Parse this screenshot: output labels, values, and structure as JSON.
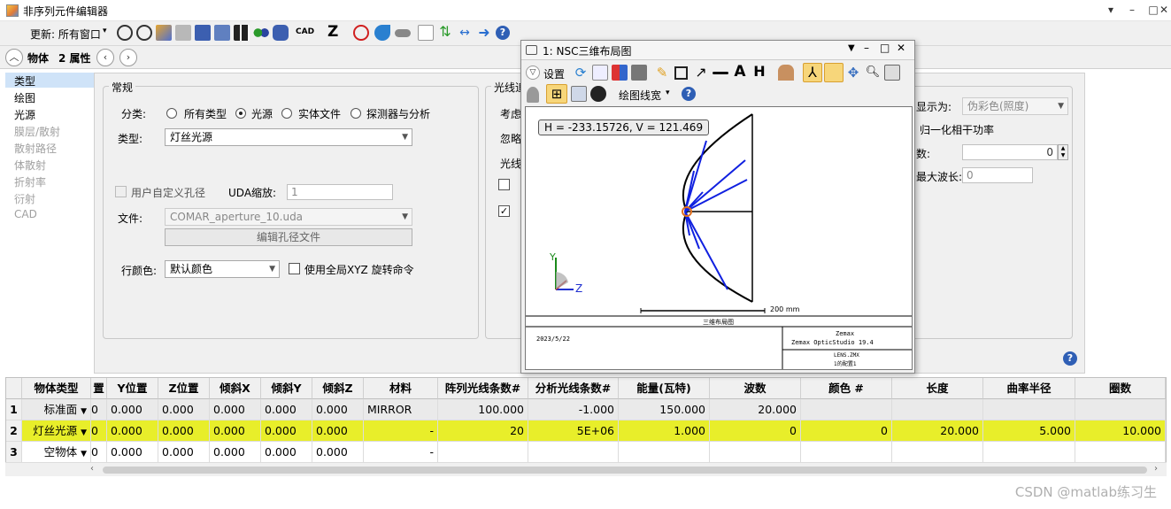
{
  "window": {
    "title": "非序列元件编辑器",
    "min": "–",
    "max": "□",
    "close": "✕",
    "pin": "▾"
  },
  "toolbar": {
    "update_label": "更新: 所有窗口",
    "cad_label": "CAD",
    "z_label": "Z"
  },
  "subbar": {
    "tab_object": "物体",
    "tab_props": "2 属性"
  },
  "nav": {
    "items": [
      {
        "label": "类型",
        "active": true,
        "enabled": true
      },
      {
        "label": "绘图",
        "enabled": true
      },
      {
        "label": "光源",
        "enabled": true
      },
      {
        "label": "膜层/散射",
        "enabled": false
      },
      {
        "label": "散射路径",
        "enabled": false
      },
      {
        "label": " 体散射",
        "enabled": false
      },
      {
        "label": "折射率",
        "enabled": false
      },
      {
        "label": "衍射",
        "enabled": false
      },
      {
        "label": " CAD",
        "enabled": false
      }
    ]
  },
  "general": {
    "group_title": "常规",
    "category_label": "分类:",
    "radios": [
      "所有类型",
      "光源",
      "实体文件",
      "探测器与分析"
    ],
    "type_label": "类型:",
    "type_value": "灯丝光源",
    "user_aperture_label": "用户自定义孔径",
    "uda_scale_label": "UDA缩放:",
    "uda_scale_value": "1",
    "file_label": "文件:",
    "file_value": "COMAR_aperture_10.uda",
    "edit_aperture_button": "编辑孔径文件",
    "row_color_label": "行颜色:",
    "row_color_value": "默认颜色",
    "global_xyz_label": "使用全局XYZ 旋转命令"
  },
  "raytrace": {
    "group_title": "光线追",
    "lines": [
      "考虑",
      "忽略",
      "光线"
    ]
  },
  "right_panel": {
    "display_label": "显示为:",
    "display_value": "伪彩色(照度)",
    "normalize_label": "归一化相干功率",
    "num_label": "数:",
    "num_value": "0",
    "max_wave_label": "最大波长:",
    "max_wave_value": "0"
  },
  "float_window": {
    "title": "1: NSC三维布局图",
    "settings_label": "设置",
    "linewidth_label": "绘图线宽",
    "coord_readout": "H = -233.15726, V = 121.469",
    "axis_y": "Y",
    "axis_z": "Z",
    "scale_label": "200 mm",
    "footer_title": "三维布局图",
    "footer_date": "2023/5/22",
    "footer_brand": "Zemax",
    "footer_product": "Zemax OpticStudio 19.4",
    "footer_file": "LENS.ZMX",
    "footer_config": "1的配置1"
  },
  "grid": {
    "headers": [
      "物体类型",
      "置",
      "Y位置",
      "Z位置",
      "倾斜X",
      "倾斜Y",
      "倾斜Z",
      "材料",
      "阵列光线条数#",
      "分析光线条数#",
      "能量(瓦特)",
      "波数",
      "颜色 #",
      "长度",
      "曲率半径",
      "圈数"
    ],
    "rows": [
      {
        "num": "1",
        "type": "标准面",
        "x": "0",
        "y": "0.000",
        "z": "0.000",
        "tx": "0.000",
        "ty": "0.000",
        "tz": "0.000",
        "mat": "MIRROR",
        "layout_rays": "100.000",
        "anal_rays": "-1.000",
        "power": "150.000",
        "waves": "20.000",
        "color": "",
        "length": "",
        "radius": "",
        "turns": ""
      },
      {
        "num": "2",
        "type": "灯丝光源",
        "x": "0",
        "y": "0.000",
        "z": "0.000",
        "tx": "0.000",
        "ty": "0.000",
        "tz": "0.000",
        "mat": "-",
        "layout_rays": "20",
        "anal_rays": "5E+06",
        "power": "1.000",
        "waves": "0",
        "color": "0",
        "length": "20.000",
        "radius": "5.000",
        "turns": "10.000"
      },
      {
        "num": "3",
        "type": "空物体",
        "x": "0",
        "y": "0.000",
        "z": "0.000",
        "tx": "0.000",
        "ty": "0.000",
        "tz": "0.000",
        "mat": "-",
        "layout_rays": "",
        "anal_rays": "",
        "power": "",
        "waves": "",
        "color": "",
        "length": "",
        "radius": "",
        "turns": ""
      }
    ]
  },
  "watermark": "CSDN @matlab练习生",
  "colors": {
    "highlight_row": "#e8ee2a",
    "ray_blue": "#1020e0",
    "help_blue": "#2f5fb5"
  }
}
